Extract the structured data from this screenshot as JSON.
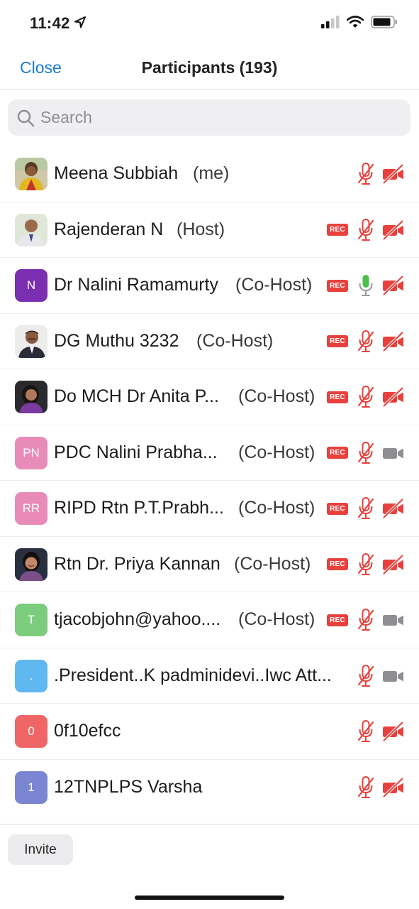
{
  "status_bar": {
    "time": "11:42"
  },
  "nav": {
    "close_label": "Close",
    "title": "Participants (193)"
  },
  "search": {
    "placeholder": "Search"
  },
  "colors": {
    "accent": "#1a7ad6",
    "muted_red": "#e8413d",
    "mic_on_green": "#4cc04a",
    "cam_on_gray": "#8e8e93"
  },
  "participants": [
    {
      "name": "Meena Subbiah",
      "role": "(me)",
      "avatar": {
        "type": "photo"
      },
      "rec": false,
      "mic": "muted",
      "video": "off"
    },
    {
      "name": "Rajenderan N",
      "role": "(Host)",
      "avatar": {
        "type": "photo"
      },
      "rec": true,
      "mic": "muted",
      "video": "off"
    },
    {
      "name": "Dr Nalini Ramamurty",
      "role": "(Co-Host)",
      "avatar": {
        "type": "initials",
        "initials": "N",
        "color": "#7a2fb0"
      },
      "rec": true,
      "mic": "on",
      "video": "off"
    },
    {
      "name": "DG Muthu 3232",
      "role": "(Co-Host)",
      "avatar": {
        "type": "photo"
      },
      "rec": true,
      "mic": "muted",
      "video": "off"
    },
    {
      "name": "Do MCH Dr Anita P...",
      "role": "(Co-Host)",
      "avatar": {
        "type": "photo"
      },
      "rec": true,
      "mic": "muted",
      "video": "off"
    },
    {
      "name": "PDC Nalini Prabha...",
      "role": "(Co-Host)",
      "avatar": {
        "type": "initials",
        "initials": "PN",
        "color": "#e88bb8"
      },
      "rec": true,
      "mic": "muted",
      "video": "on"
    },
    {
      "name": "RIPD Rtn P.T.Prabh...",
      "role": "(Co-Host)",
      "avatar": {
        "type": "initials",
        "initials": "RR",
        "color": "#e88bb8"
      },
      "rec": true,
      "mic": "muted",
      "video": "off"
    },
    {
      "name": "Rtn Dr. Priya Kannan",
      "role": "(Co-Host)",
      "avatar": {
        "type": "photo"
      },
      "rec": true,
      "mic": "muted",
      "video": "off"
    },
    {
      "name": "tjacobjohn@yahoo....",
      "role": "(Co-Host)",
      "avatar": {
        "type": "initials",
        "initials": "T",
        "color": "#7ccc7e"
      },
      "rec": true,
      "mic": "muted",
      "video": "on"
    },
    {
      "name": ".President..K padminidevi..Iwc Att...",
      "role": "",
      "avatar": {
        "type": "initials",
        "initials": ".",
        "color": "#5fb8f0"
      },
      "rec": false,
      "mic": "muted",
      "video": "on"
    },
    {
      "name": "0f10efcc",
      "role": "",
      "avatar": {
        "type": "initials",
        "initials": "0",
        "color": "#f06666"
      },
      "rec": false,
      "mic": "muted",
      "video": "off"
    },
    {
      "name": "12TNPLPS Varsha",
      "role": "",
      "avatar": {
        "type": "initials",
        "initials": "1",
        "color": "#7b86d2"
      },
      "rec": false,
      "mic": "muted",
      "video": "off"
    }
  ],
  "footer": {
    "invite_label": "Invite"
  }
}
